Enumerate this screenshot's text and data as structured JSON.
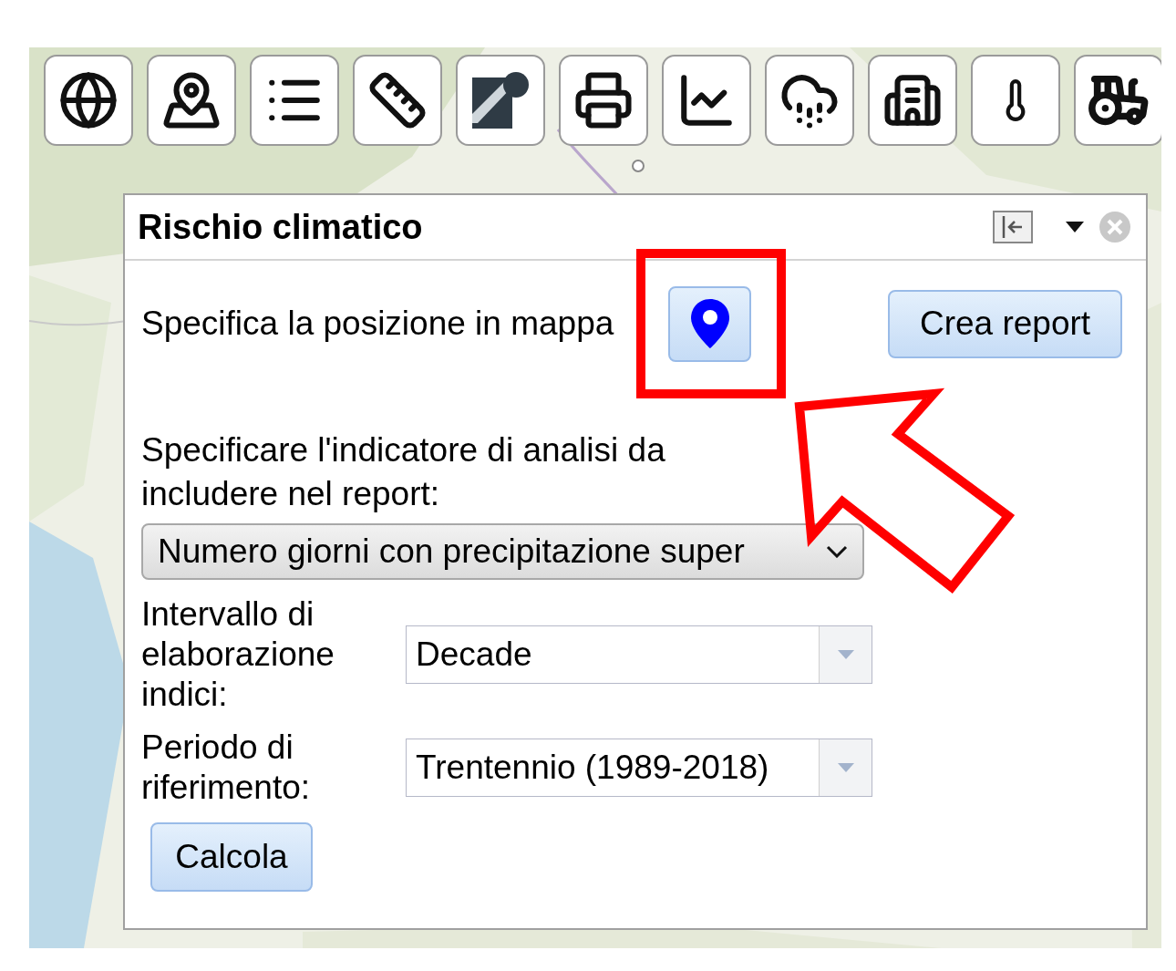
{
  "toolbar": [
    {
      "kind": "globe"
    },
    {
      "kind": "map"
    },
    {
      "kind": "list"
    },
    {
      "kind": "ruler"
    },
    {
      "kind": "basemap"
    },
    {
      "kind": "printer"
    },
    {
      "kind": "chart"
    },
    {
      "kind": "storm"
    },
    {
      "kind": "buildings"
    },
    {
      "kind": "thermometer"
    },
    {
      "kind": "tractor"
    }
  ],
  "panel": {
    "title": "Rischio climatico",
    "location_label": "Specifica la posizione in mappa",
    "location_button_highlighted": true,
    "report_button": "Crea report",
    "indicator_label": "Specificare l'indicatore di analisi da includere nel report:",
    "indicator_select": "Numero giorni con precipitazione super",
    "fields": [
      {
        "label": "Intervallo di elaborazione indici:",
        "value": "Decade"
      },
      {
        "label": "Periodo di riferimento:",
        "value": "Trentennio (1989-2018)"
      }
    ],
    "calculate_button": "Calcola"
  }
}
